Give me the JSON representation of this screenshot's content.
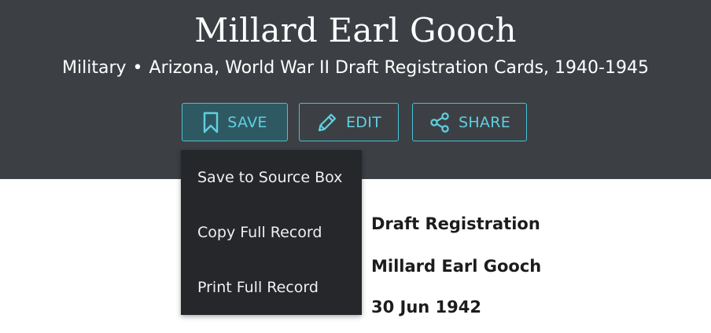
{
  "header": {
    "title": "Millard Earl Gooch",
    "category": "Military",
    "separator": "•",
    "collection": "Arizona, World War II Draft Registration Cards, 1940-1945"
  },
  "actions": {
    "save_label": "SAVE",
    "edit_label": "EDIT",
    "share_label": "SHARE"
  },
  "save_menu": {
    "items": [
      {
        "label": "Save to Source Box"
      },
      {
        "label": "Copy Full Record"
      },
      {
        "label": "Print Full Record"
      }
    ]
  },
  "details": [
    "Draft Registration",
    "Millard Earl Gooch",
    "30 Jun 1942"
  ],
  "colors": {
    "header_bg": "#3c4045",
    "accent": "#45c2d6",
    "menu_bg": "#25272a"
  },
  "icons": {
    "save": "bookmark-icon",
    "edit": "pencil-icon",
    "share": "share-icon"
  }
}
